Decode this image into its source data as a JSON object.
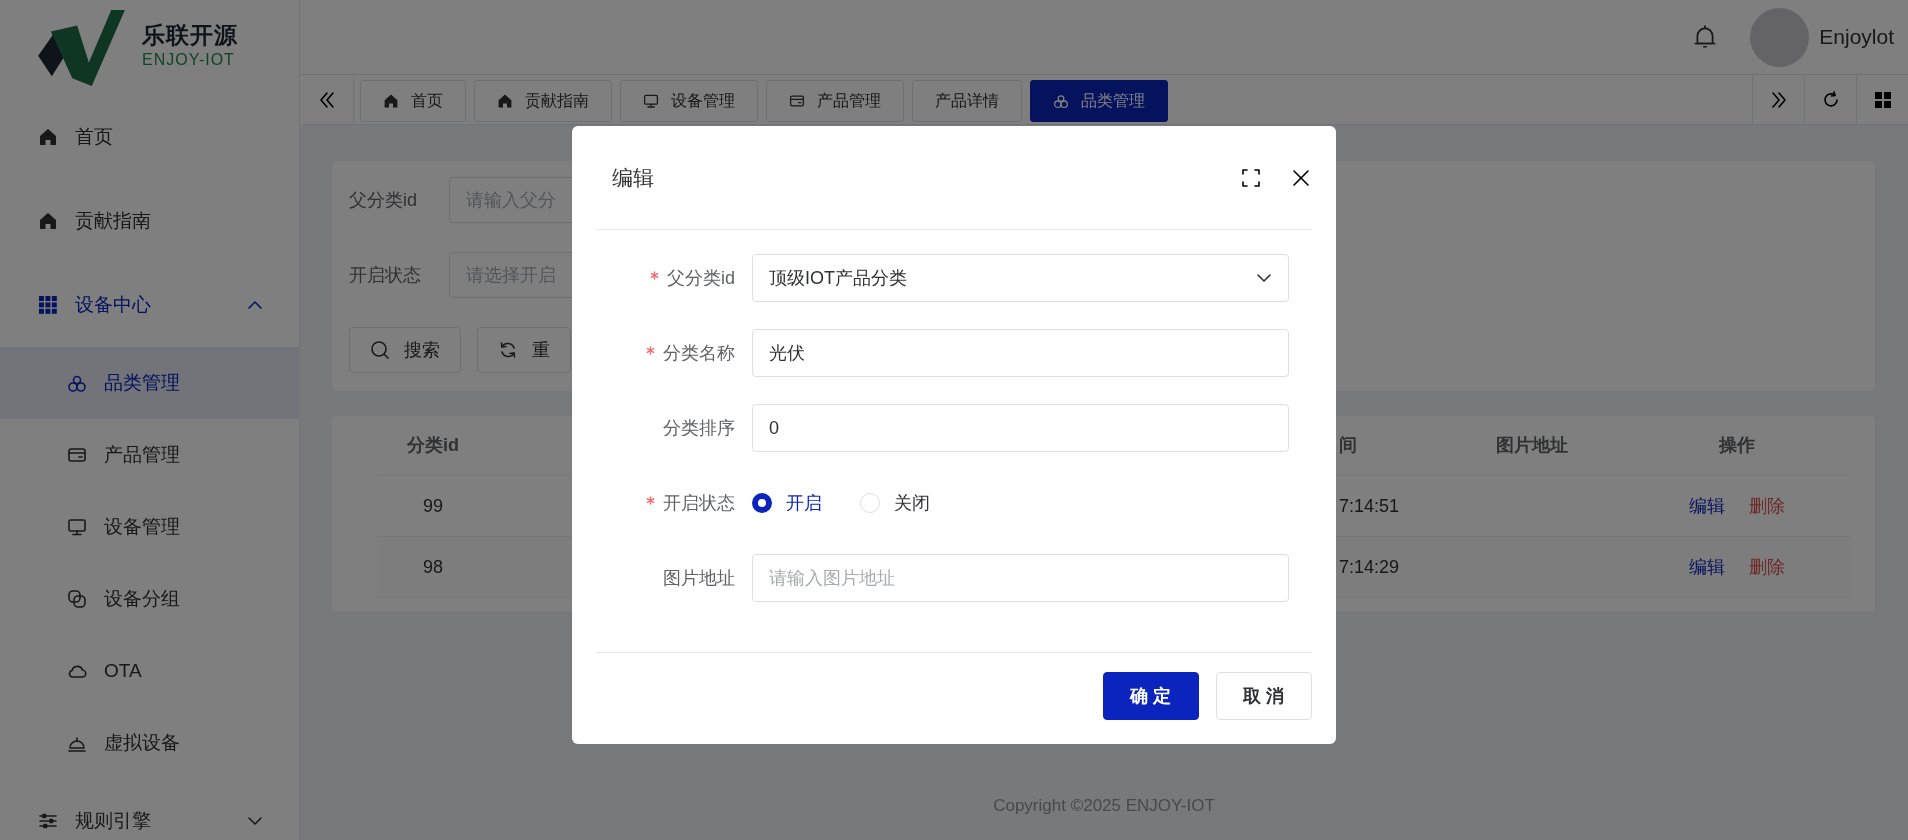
{
  "brand": {
    "name": "乐联开源",
    "subtitle": "ENJOY-IOT"
  },
  "sidebar": {
    "items": [
      {
        "label": "首页",
        "selected": false
      },
      {
        "label": "贡献指南",
        "selected": false
      },
      {
        "label": "设备中心",
        "selected": false,
        "expanded": true,
        "children": [
          {
            "label": "品类管理",
            "selected": true
          },
          {
            "label": "产品管理",
            "selected": false
          },
          {
            "label": "设备管理",
            "selected": false
          },
          {
            "label": "设备分组",
            "selected": false
          },
          {
            "label": "OTA",
            "selected": false
          },
          {
            "label": "虚拟设备",
            "selected": false
          }
        ]
      },
      {
        "label": "规则引擎",
        "selected": false,
        "expanded": false
      }
    ]
  },
  "header": {
    "user": "Enjoylot"
  },
  "tabs": [
    {
      "label": "首页",
      "selected": false
    },
    {
      "label": "贡献指南",
      "selected": false
    },
    {
      "label": "设备管理",
      "selected": false
    },
    {
      "label": "产品管理",
      "selected": false
    },
    {
      "label": "产品详情",
      "selected": false
    },
    {
      "label": "品类管理",
      "selected": true
    }
  ],
  "search": {
    "fields": [
      {
        "label": "父分类id",
        "placeholder": "请输入父分"
      },
      {
        "label": "开启状态",
        "placeholder": "请选择开启"
      }
    ],
    "buttons": [
      "搜索",
      "重"
    ]
  },
  "table": {
    "columns": [
      "分类id",
      "间",
      "图片地址",
      "操作"
    ],
    "rows": [
      {
        "column_1": "99",
        "column_2": "7:14:51",
        "actions": [
          "编辑",
          "删除"
        ]
      },
      {
        "column_1": "98",
        "column_2": "7:14:29",
        "actions": [
          "编辑",
          "删除"
        ]
      }
    ]
  },
  "footer": "Copyright ©2025 ENJOY-IOT",
  "dialog": {
    "title": "编辑",
    "fields": [
      {
        "kind": "select",
        "label": "父分类id",
        "required": true,
        "value": "顶级IOT产品分类"
      },
      {
        "kind": "text",
        "label": "分类名称",
        "required": true,
        "value": "光伏"
      },
      {
        "kind": "text",
        "label": "分类排序",
        "required": false,
        "value": "0"
      },
      {
        "kind": "radio",
        "label": "开启状态",
        "required": true,
        "options": [
          {
            "label": "开启",
            "selected": true
          },
          {
            "label": "关闭",
            "selected": false
          }
        ]
      },
      {
        "kind": "text",
        "label": "图片地址",
        "required": false,
        "placeholder": "请输入图片地址"
      }
    ],
    "buttons": [
      {
        "label": "确 定",
        "kind": "primary"
      },
      {
        "label": "取 消",
        "kind": "default"
      }
    ]
  }
}
